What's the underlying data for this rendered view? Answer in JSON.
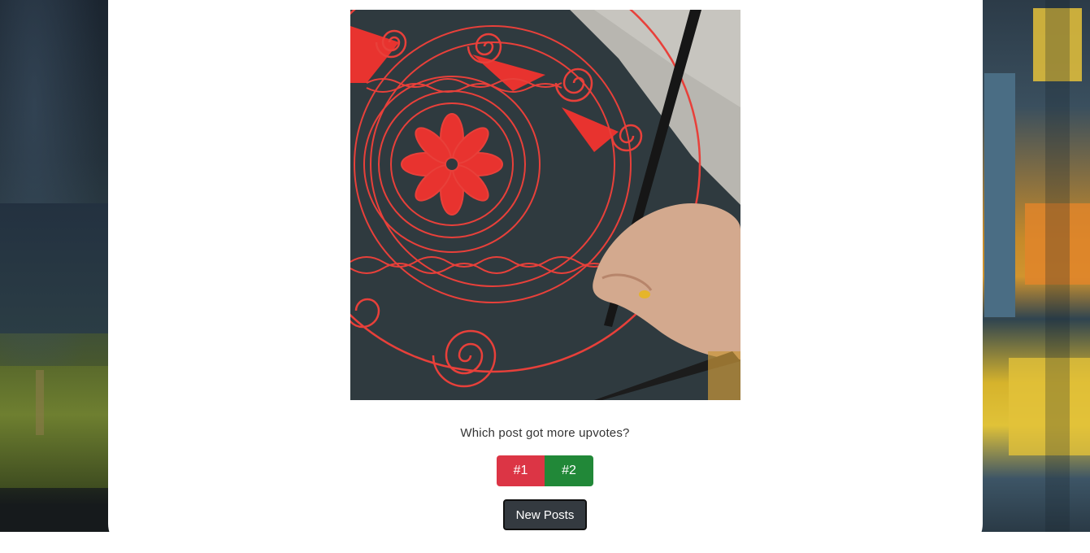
{
  "post": {
    "image_alt": "Hand drawing red spiral mandala pattern on dark surface with a pen",
    "image_icon": "artwork-image"
  },
  "quiz": {
    "question": "Which post got more upvotes?",
    "option_1_label": "#1",
    "option_2_label": "#2",
    "new_posts_label": "New Posts"
  },
  "colors": {
    "option_1": "#dc3545",
    "option_2": "#218838",
    "new_posts": "#343a40",
    "card": "#ffffff"
  }
}
